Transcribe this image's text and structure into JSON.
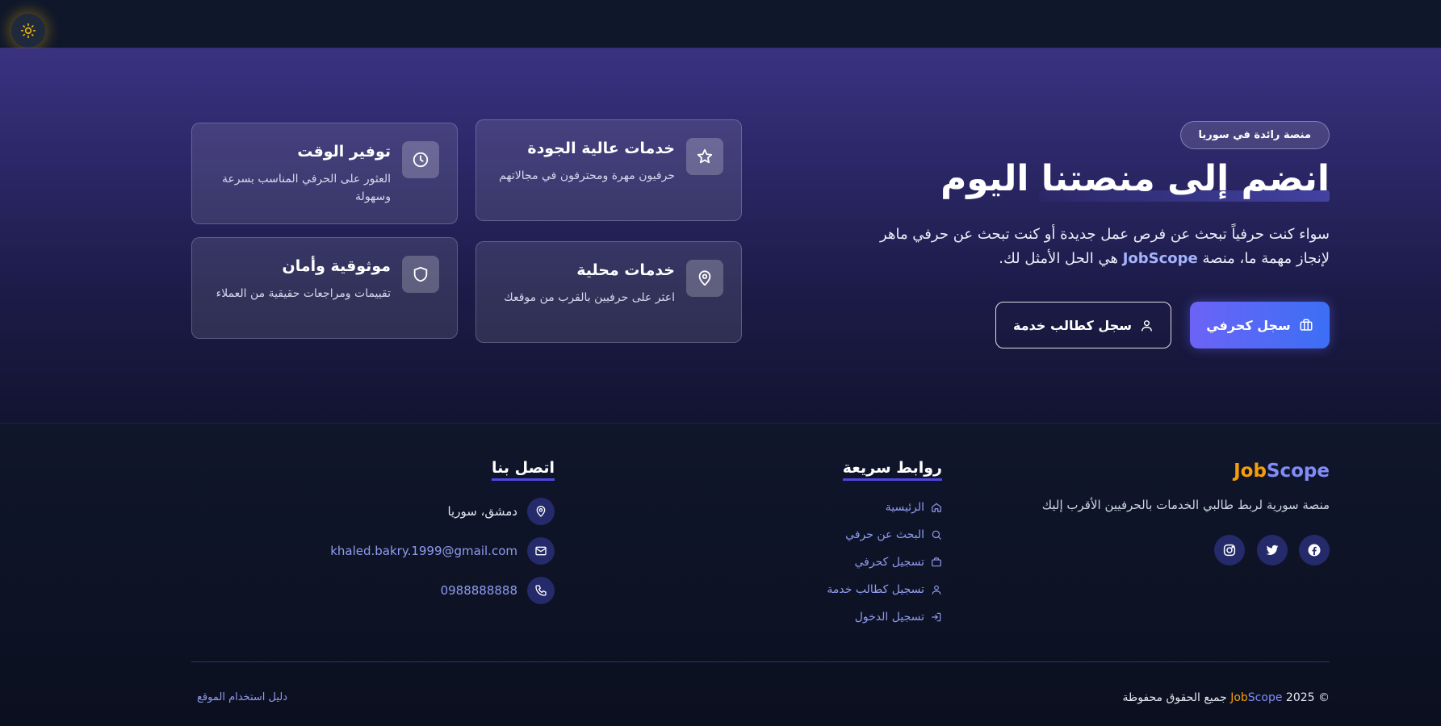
{
  "topbar": {
    "theme_icon": "sun-icon"
  },
  "hero": {
    "badge": "منصة رائدة في سوريا",
    "title": "انضم إلى منصتنا اليوم",
    "description_part1": "سواء كنت حرفياً تبحث عن فرص عمل جديدة أو كنت تبحث عن حرفي ماهر لإنجاز مهمة ما، منصة ",
    "description_brand": "JobScope",
    "description_part2": " هي الحل الأمثل لك.",
    "primary_button": "سجل كحرفي",
    "secondary_button": "سجل كطالب خدمة",
    "features": [
      {
        "title": "خدمات عالية الجودة",
        "desc": "حرفيون مهرة ومحترفون في مجالاتهم",
        "icon": "star-icon"
      },
      {
        "title": "توفير الوقت",
        "desc": "العثور على الحرفي المناسب بسرعة وسهولة",
        "icon": "clock-icon"
      },
      {
        "title": "خدمات محلية",
        "desc": "اعثر على حرفيين بالقرب من موقعك",
        "icon": "map-pin-icon"
      },
      {
        "title": "موثوقية وأمان",
        "desc": "تقييمات ومراجعات حقيقية من العملاء",
        "icon": "shield-icon"
      }
    ]
  },
  "footer": {
    "brand_part1": "Job",
    "brand_part2": "Scope",
    "tagline": "منصة سورية لربط طالبي الخدمات بالحرفيين الأقرب إليك",
    "social": [
      "facebook-icon",
      "twitter-icon",
      "instagram-icon"
    ],
    "quick_links_title": "روابط سريعة",
    "quick_links": [
      {
        "label": "الرئيسية",
        "icon": "home-icon"
      },
      {
        "label": "البحث عن حرفي",
        "icon": "search-icon"
      },
      {
        "label": "تسجيل كحرفي",
        "icon": "briefcase-icon"
      },
      {
        "label": "تسجيل كطالب خدمة",
        "icon": "user-icon"
      },
      {
        "label": "تسجيل الدخول",
        "icon": "login-icon"
      }
    ],
    "contact_title": "اتصل بنا",
    "contact": {
      "address": "دمشق، سوريا",
      "email": "khaled.bakry.1999@gmail.com",
      "phone": "0988888888"
    },
    "copyright_prefix": "© 2025 ",
    "copyright_brand1": "Job",
    "copyright_brand2": "Scope",
    "copyright_suffix": " جميع الحقوق محفوظة",
    "guide_link": "دليل استخدام الموقع"
  },
  "colors": {
    "accent": "#6366f1",
    "brand_orange": "#f59e0b",
    "brand_blue": "#818cf8",
    "background": "#0b1020"
  }
}
